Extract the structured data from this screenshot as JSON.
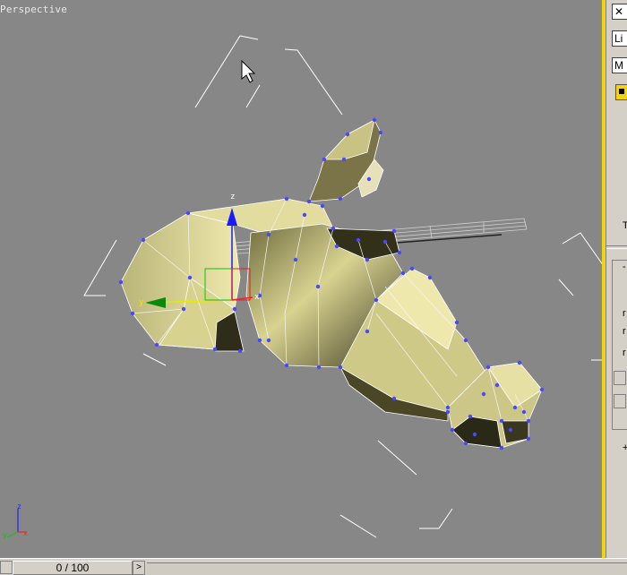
{
  "viewport": {
    "label": "Perspective"
  },
  "command_panel": {
    "field1_text": "Li",
    "field2_text": "M",
    "tab_glyph": "T",
    "dash_glyph": "-",
    "plus_glyph": "+",
    "label_letters": [
      "r",
      "r",
      "r"
    ]
  },
  "time_slider": {
    "frame_text": "0 / 100",
    "next_glyph": ">"
  },
  "colors": {
    "viewport_bg": "#878787",
    "active_border": "#f3d30b",
    "vertex": "#4848ff",
    "mesh": "#d8d28a"
  }
}
